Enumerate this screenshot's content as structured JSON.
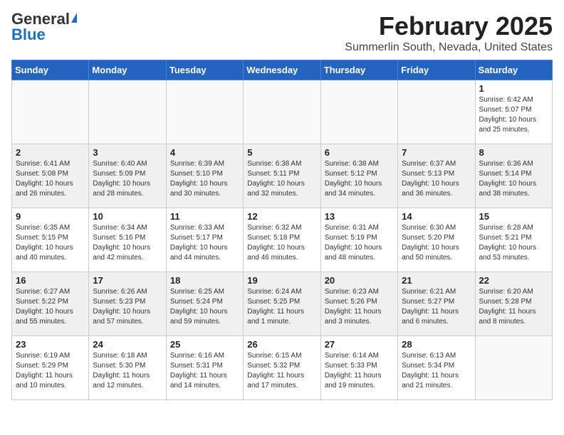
{
  "header": {
    "logo_general": "General",
    "logo_blue": "Blue",
    "month_title": "February 2025",
    "location": "Summerlin South, Nevada, United States"
  },
  "days_of_week": [
    "Sunday",
    "Monday",
    "Tuesday",
    "Wednesday",
    "Thursday",
    "Friday",
    "Saturday"
  ],
  "weeks": [
    [
      {
        "day": "",
        "info": ""
      },
      {
        "day": "",
        "info": ""
      },
      {
        "day": "",
        "info": ""
      },
      {
        "day": "",
        "info": ""
      },
      {
        "day": "",
        "info": ""
      },
      {
        "day": "",
        "info": ""
      },
      {
        "day": "1",
        "info": "Sunrise: 6:42 AM\nSunset: 5:07 PM\nDaylight: 10 hours and 25 minutes."
      }
    ],
    [
      {
        "day": "2",
        "info": "Sunrise: 6:41 AM\nSunset: 5:08 PM\nDaylight: 10 hours and 26 minutes."
      },
      {
        "day": "3",
        "info": "Sunrise: 6:40 AM\nSunset: 5:09 PM\nDaylight: 10 hours and 28 minutes."
      },
      {
        "day": "4",
        "info": "Sunrise: 6:39 AM\nSunset: 5:10 PM\nDaylight: 10 hours and 30 minutes."
      },
      {
        "day": "5",
        "info": "Sunrise: 6:38 AM\nSunset: 5:11 PM\nDaylight: 10 hours and 32 minutes."
      },
      {
        "day": "6",
        "info": "Sunrise: 6:38 AM\nSunset: 5:12 PM\nDaylight: 10 hours and 34 minutes."
      },
      {
        "day": "7",
        "info": "Sunrise: 6:37 AM\nSunset: 5:13 PM\nDaylight: 10 hours and 36 minutes."
      },
      {
        "day": "8",
        "info": "Sunrise: 6:36 AM\nSunset: 5:14 PM\nDaylight: 10 hours and 38 minutes."
      }
    ],
    [
      {
        "day": "9",
        "info": "Sunrise: 6:35 AM\nSunset: 5:15 PM\nDaylight: 10 hours and 40 minutes."
      },
      {
        "day": "10",
        "info": "Sunrise: 6:34 AM\nSunset: 5:16 PM\nDaylight: 10 hours and 42 minutes."
      },
      {
        "day": "11",
        "info": "Sunrise: 6:33 AM\nSunset: 5:17 PM\nDaylight: 10 hours and 44 minutes."
      },
      {
        "day": "12",
        "info": "Sunrise: 6:32 AM\nSunset: 5:18 PM\nDaylight: 10 hours and 46 minutes."
      },
      {
        "day": "13",
        "info": "Sunrise: 6:31 AM\nSunset: 5:19 PM\nDaylight: 10 hours and 48 minutes."
      },
      {
        "day": "14",
        "info": "Sunrise: 6:30 AM\nSunset: 5:20 PM\nDaylight: 10 hours and 50 minutes."
      },
      {
        "day": "15",
        "info": "Sunrise: 6:28 AM\nSunset: 5:21 PM\nDaylight: 10 hours and 53 minutes."
      }
    ],
    [
      {
        "day": "16",
        "info": "Sunrise: 6:27 AM\nSunset: 5:22 PM\nDaylight: 10 hours and 55 minutes."
      },
      {
        "day": "17",
        "info": "Sunrise: 6:26 AM\nSunset: 5:23 PM\nDaylight: 10 hours and 57 minutes."
      },
      {
        "day": "18",
        "info": "Sunrise: 6:25 AM\nSunset: 5:24 PM\nDaylight: 10 hours and 59 minutes."
      },
      {
        "day": "19",
        "info": "Sunrise: 6:24 AM\nSunset: 5:25 PM\nDaylight: 11 hours and 1 minute."
      },
      {
        "day": "20",
        "info": "Sunrise: 6:23 AM\nSunset: 5:26 PM\nDaylight: 11 hours and 3 minutes."
      },
      {
        "day": "21",
        "info": "Sunrise: 6:21 AM\nSunset: 5:27 PM\nDaylight: 11 hours and 6 minutes."
      },
      {
        "day": "22",
        "info": "Sunrise: 6:20 AM\nSunset: 5:28 PM\nDaylight: 11 hours and 8 minutes."
      }
    ],
    [
      {
        "day": "23",
        "info": "Sunrise: 6:19 AM\nSunset: 5:29 PM\nDaylight: 11 hours and 10 minutes."
      },
      {
        "day": "24",
        "info": "Sunrise: 6:18 AM\nSunset: 5:30 PM\nDaylight: 11 hours and 12 minutes."
      },
      {
        "day": "25",
        "info": "Sunrise: 6:16 AM\nSunset: 5:31 PM\nDaylight: 11 hours and 14 minutes."
      },
      {
        "day": "26",
        "info": "Sunrise: 6:15 AM\nSunset: 5:32 PM\nDaylight: 11 hours and 17 minutes."
      },
      {
        "day": "27",
        "info": "Sunrise: 6:14 AM\nSunset: 5:33 PM\nDaylight: 11 hours and 19 minutes."
      },
      {
        "day": "28",
        "info": "Sunrise: 6:13 AM\nSunset: 5:34 PM\nDaylight: 11 hours and 21 minutes."
      },
      {
        "day": "",
        "info": ""
      }
    ]
  ]
}
